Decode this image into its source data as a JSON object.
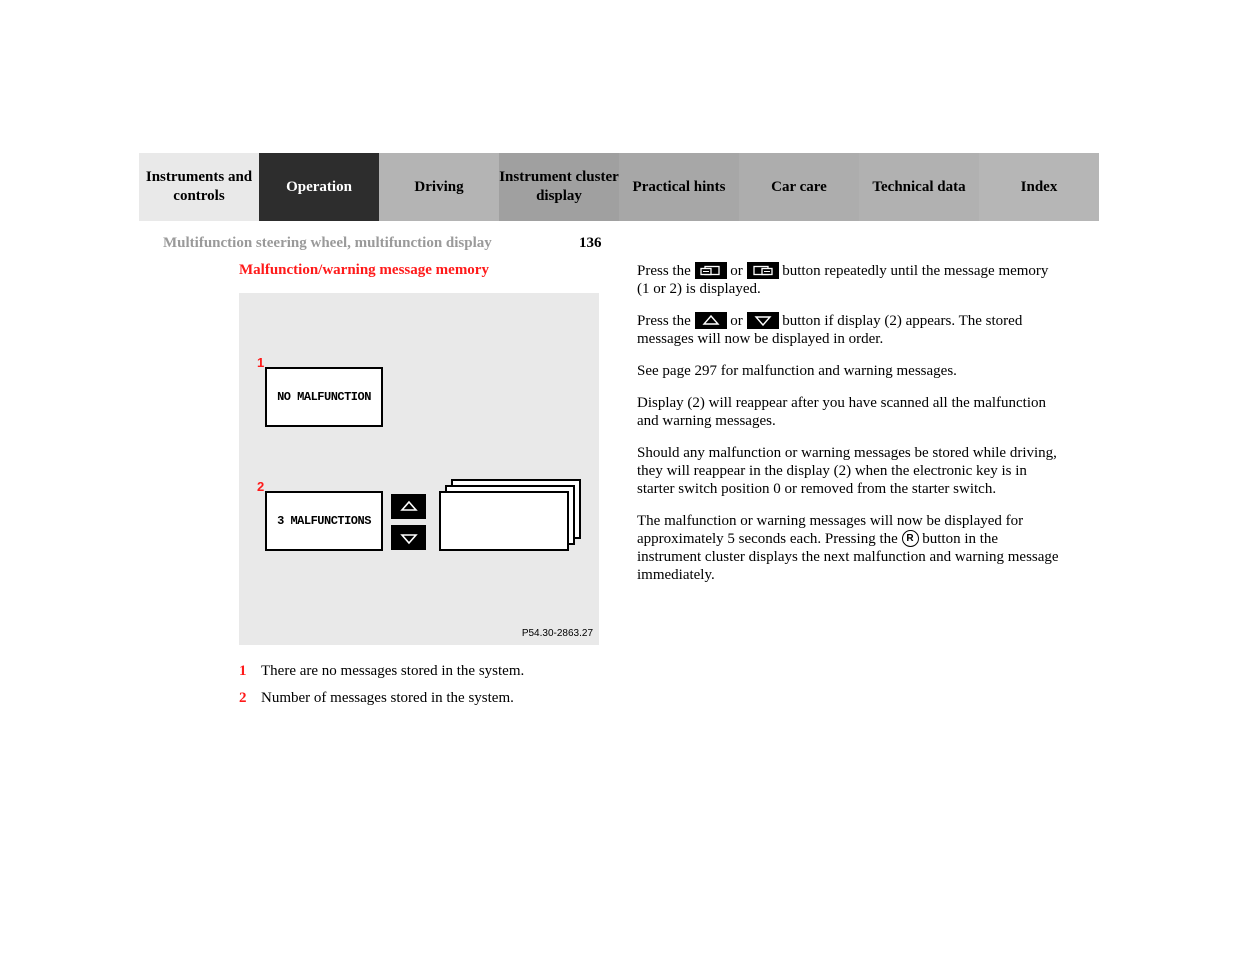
{
  "tabs": [
    "Instruments and controls",
    "Operation",
    "Driving",
    "Instrument cluster display",
    "Practical hints",
    "Car care",
    "Technical data",
    "Index"
  ],
  "breadcrumb": {
    "title": "Multifunction steering wheel, multifunction display",
    "page": "136"
  },
  "section_title": "Malfunction/warning message memory",
  "illustration": {
    "label1": "1",
    "label2": "2",
    "box1_text": "NO MALFUNCTION",
    "box2_text": "3 MALFUNCTIONS",
    "code": "P54.30-2863.27"
  },
  "legend": [
    {
      "num": "1",
      "text": "There are no messages stored in the system."
    },
    {
      "num": "2",
      "text": "Number of messages stored in the system."
    }
  ],
  "right": {
    "p1a": "Press the ",
    "p1b": " or ",
    "p1c": " button repeatedly until the message memory (1 or 2) is displayed.",
    "p2a": "Press the ",
    "p2b": " or ",
    "p2c": " button if display (2) appears. The stored messages will now be displayed in order.",
    "p3": "See page 297 for malfunction and warning messages.",
    "p4": "Display (2) will reappear after you have scanned all the malfunction and warning messages.",
    "p5": "Should any malfunction or warning messages be stored while driving, they will reappear in the display (2) when the electronic key is in starter switch position 0 or removed from the starter switch.",
    "p6a": "The malfunction or warning messages will now be displayed for approximately 5 seconds each. Pressing the ",
    "p6b": " button in the instrument cluster displays the next malfunction and warning message immediately.",
    "circ_r": "R"
  }
}
